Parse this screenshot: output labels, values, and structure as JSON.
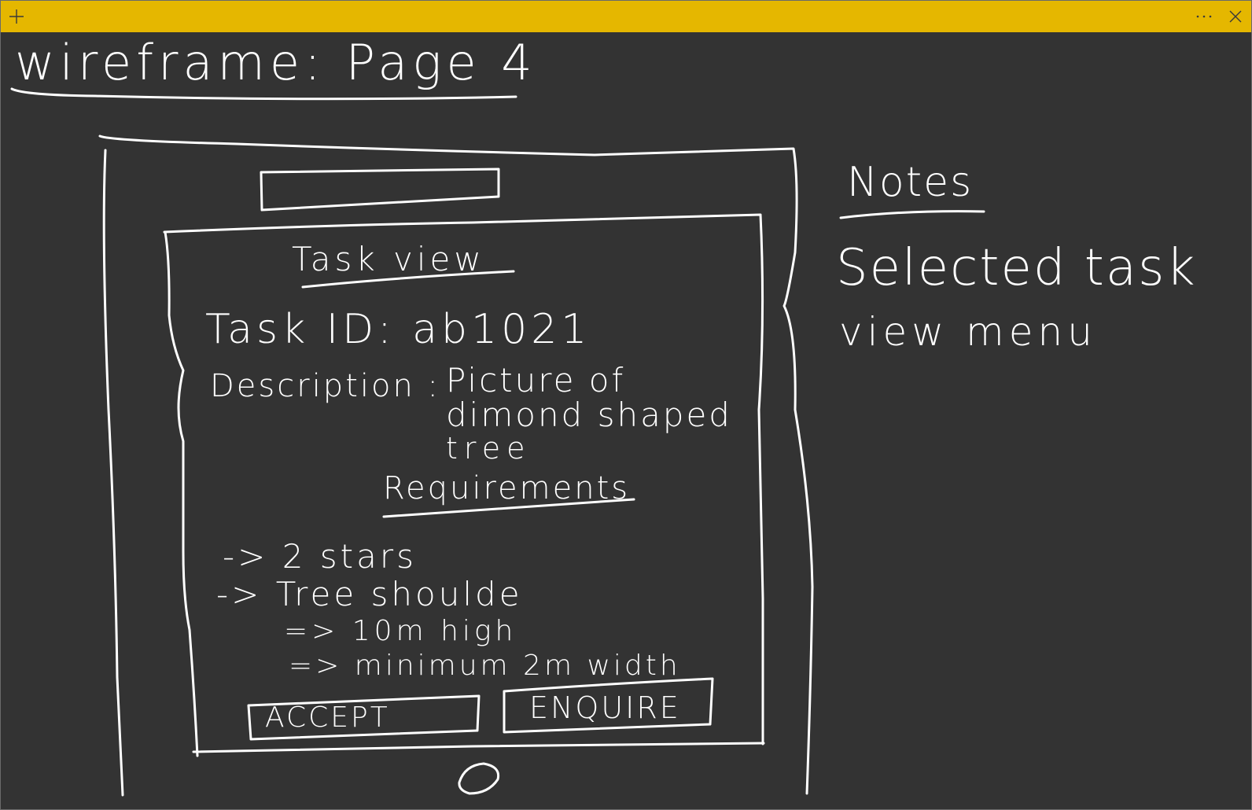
{
  "titlebar": {
    "color": "#e5b700",
    "add_icon": "plus-icon",
    "more_icon": "more-icon",
    "close_icon": "close-icon"
  },
  "canvas": {
    "background": "#333333",
    "ink_color": "#ffffff"
  },
  "heading": {
    "title": "wireframe:  Page 4"
  },
  "notes": {
    "title": "Notes",
    "line1": "Selected  task",
    "line2": "view    menu"
  },
  "mockup": {
    "header_label": "Task view",
    "task_id": "Task ID: ab1021",
    "description_label": "Description :",
    "description_line1": "Picture  of",
    "description_line2": "dimond  shaped",
    "description_line3": "tree",
    "requirements_title": "Requirements",
    "req1": "-> 2  stars",
    "req2": "->  Tree  shoulde",
    "req2_sub1": "=>  10m   high",
    "req2_sub2": "=>  minimum  2m  width",
    "accept_label": "ACCEPT",
    "enquire_label": "ENQUIRE"
  }
}
